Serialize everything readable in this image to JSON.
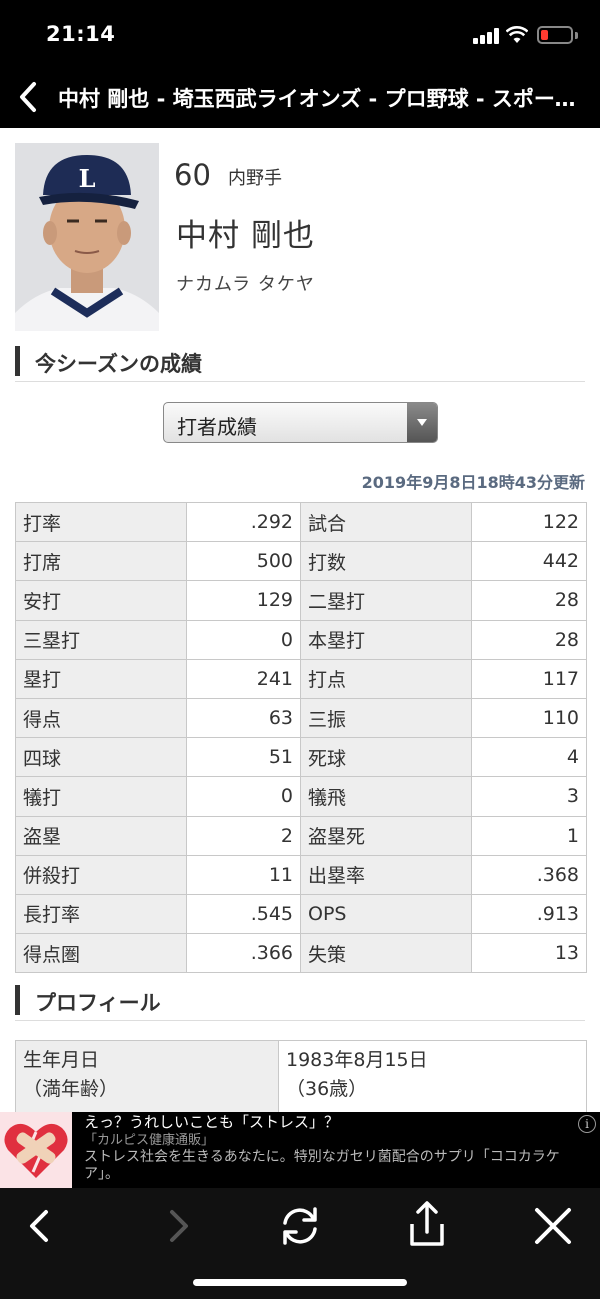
{
  "status_bar": {
    "time": "21:14"
  },
  "header": {
    "title": "中村 剛也 - 埼玉西武ライオンズ - プロ野球 - スポーツナビ"
  },
  "player": {
    "number": "60",
    "position": "内野手",
    "name": "中村 剛也",
    "kana": "ナカムラ タケヤ",
    "cap_logo": "L"
  },
  "season_section": {
    "title": "今シーズンの成績"
  },
  "stat_type_select": {
    "selected": "打者成績"
  },
  "updated_at": "2019年9月8日18時43分更新",
  "stats_rows": [
    {
      "l1": "打率",
      "v1": ".292",
      "l2": "試合",
      "v2": "122"
    },
    {
      "l1": "打席",
      "v1": "500",
      "l2": "打数",
      "v2": "442"
    },
    {
      "l1": "安打",
      "v1": "129",
      "l2": "二塁打",
      "v2": "28"
    },
    {
      "l1": "三塁打",
      "v1": "0",
      "l2": "本塁打",
      "v2": "28"
    },
    {
      "l1": "塁打",
      "v1": "241",
      "l2": "打点",
      "v2": "117"
    },
    {
      "l1": "得点",
      "v1": "63",
      "l2": "三振",
      "v2": "110"
    },
    {
      "l1": "四球",
      "v1": "51",
      "l2": "死球",
      "v2": "4"
    },
    {
      "l1": "犠打",
      "v1": "0",
      "l2": "犠飛",
      "v2": "3"
    },
    {
      "l1": "盗塁",
      "v1": "2",
      "l2": "盗塁死",
      "v2": "1"
    },
    {
      "l1": "併殺打",
      "v1": "11",
      "l2": "出塁率",
      "v2": ".368"
    },
    {
      "l1": "長打率",
      "v1": ".545",
      "l2": "OPS",
      "v2": ".913"
    },
    {
      "l1": "得点圏",
      "v1": ".366",
      "l2": "失策",
      "v2": "13"
    }
  ],
  "profile_section": {
    "title": "プロフィール"
  },
  "profile": {
    "birth_label": "生年月日",
    "age_label": "（満年齢）",
    "birth_value": "1983年8月15日",
    "age_value": "（36歳）"
  },
  "ad": {
    "title": "えっ？うれしいことも「ストレス」？",
    "sponsor": "「カルピス健康通販」",
    "description": "ストレス社会を生きるあなたに。特別なガセリ菌配合のサプリ「ココカラケア」。",
    "info_icon": "i"
  },
  "toolbar": {
    "icons": [
      "back-arrow-icon",
      "forward-arrow-icon",
      "reload-icon",
      "share-icon",
      "close-icon"
    ]
  },
  "colors": {
    "header_bg": "#000000",
    "table_label_bg": "#eeeeee",
    "updated_text": "#5a6a80",
    "battery_low": "#ff3b30"
  }
}
